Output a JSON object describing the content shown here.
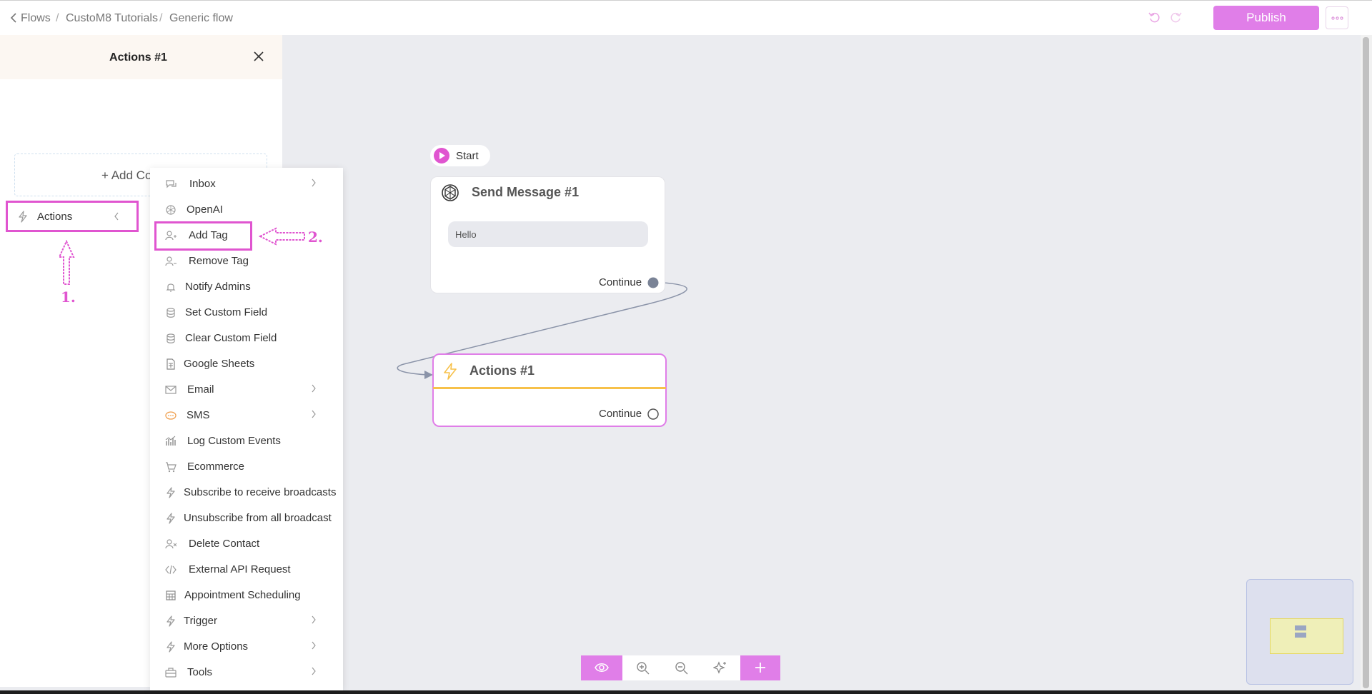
{
  "breadcrumb": {
    "back_label": "Flows",
    "items": [
      "CustoM8 Tutorials",
      "Generic flow"
    ],
    "separator": "/"
  },
  "header": {
    "publish_label": "Publish",
    "accent_color": "#e07ee8"
  },
  "side_panel": {
    "title": "Actions #1",
    "add_label": "+ Add Co",
    "actions_item_label": "Actions"
  },
  "annotations": {
    "step1": "1.",
    "step2": "2."
  },
  "menu": {
    "items": [
      {
        "label": "Inbox",
        "icon": "chat-icon",
        "has_submenu": true
      },
      {
        "label": "OpenAI",
        "icon": "openai-icon",
        "has_submenu": false
      },
      {
        "label": "Add Tag",
        "icon": "user-tag-icon",
        "has_submenu": false
      },
      {
        "label": "Remove Tag",
        "icon": "user-tag-remove-icon",
        "has_submenu": false
      },
      {
        "label": "Notify Admins",
        "icon": "bell-icon",
        "has_submenu": false
      },
      {
        "label": "Set Custom Field",
        "icon": "database-icon",
        "has_submenu": false
      },
      {
        "label": "Clear Custom Field",
        "icon": "database-clear-icon",
        "has_submenu": false
      },
      {
        "label": "Google Sheets",
        "icon": "sheet-icon",
        "has_submenu": false
      },
      {
        "label": "Email",
        "icon": "mail-icon",
        "has_submenu": true
      },
      {
        "label": "SMS",
        "icon": "sms-icon",
        "has_submenu": true
      },
      {
        "label": "Log Custom Events",
        "icon": "chart-icon",
        "has_submenu": false
      },
      {
        "label": "Ecommerce",
        "icon": "cart-icon",
        "has_submenu": false
      },
      {
        "label": "Subscribe to receive broadcasts",
        "icon": "bolt-icon",
        "has_submenu": false
      },
      {
        "label": "Unsubscribe from all broadcast",
        "icon": "bolt-icon",
        "has_submenu": false
      },
      {
        "label": "Delete Contact",
        "icon": "user-delete-icon",
        "has_submenu": false
      },
      {
        "label": "External API Request",
        "icon": "code-icon",
        "has_submenu": false
      },
      {
        "label": "Appointment Scheduling",
        "icon": "calendar-icon",
        "has_submenu": false
      },
      {
        "label": "Trigger",
        "icon": "bolt-icon",
        "has_submenu": true
      },
      {
        "label": "More Options",
        "icon": "bolt-icon",
        "has_submenu": true
      },
      {
        "label": "Tools",
        "icon": "toolbox-icon",
        "has_submenu": true
      }
    ]
  },
  "flow": {
    "start_label": "Start",
    "send_message": {
      "title": "Send Message #1",
      "message": "Hello",
      "continue_label": "Continue"
    },
    "actions_node": {
      "title": "Actions #1",
      "continue_label": "Continue"
    }
  },
  "colors": {
    "accent": "#e07ee8",
    "highlight": "#e055d0",
    "actions_bar": "#f7c14a",
    "canvas": "#ebecf0"
  }
}
